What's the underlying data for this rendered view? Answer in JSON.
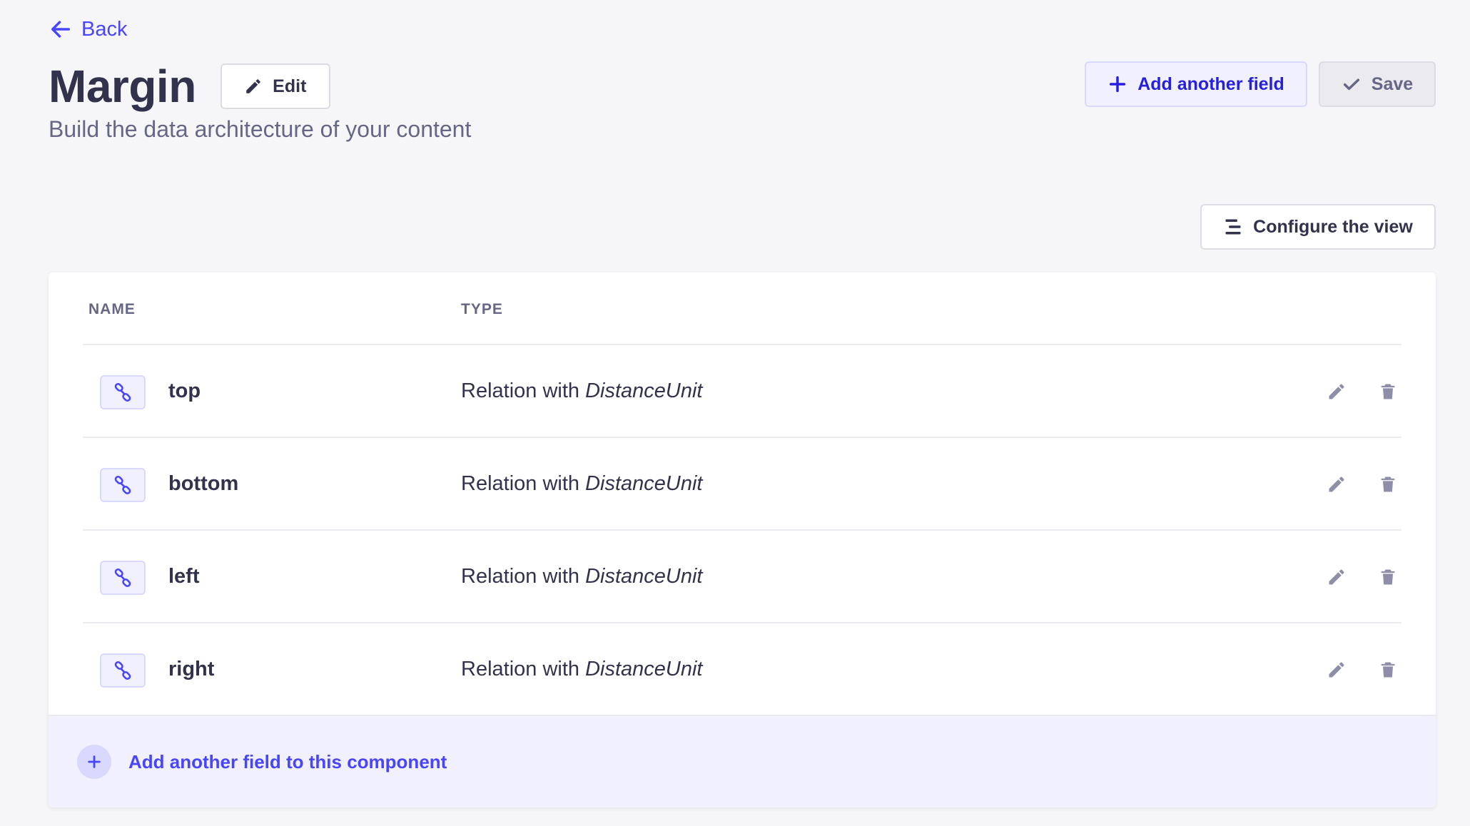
{
  "nav": {
    "back_label": "Back"
  },
  "header": {
    "title": "Margin",
    "edit_label": "Edit",
    "subtitle": "Build the data architecture of your content",
    "add_field_label": "Add another field",
    "save_label": "Save"
  },
  "view": {
    "configure_label": "Configure the view"
  },
  "table": {
    "columns": [
      "NAME",
      "TYPE"
    ],
    "rows": [
      {
        "name": "top",
        "type_prefix": "Relation with",
        "type_target": "DistanceUnit",
        "icon": "relation-icon"
      },
      {
        "name": "bottom",
        "type_prefix": "Relation with",
        "type_target": "DistanceUnit",
        "icon": "relation-icon"
      },
      {
        "name": "left",
        "type_prefix": "Relation with",
        "type_target": "DistanceUnit",
        "icon": "relation-icon"
      },
      {
        "name": "right",
        "type_prefix": "Relation with",
        "type_target": "DistanceUnit",
        "icon": "relation-icon"
      }
    ],
    "footer_label": "Add another field to this component"
  },
  "colors": {
    "primary": "#4945ff",
    "primary_light": "#f0f0ff",
    "text": "#32324d",
    "muted": "#666687",
    "icon_gray": "#8e8ea9",
    "background": "#f6f6f9"
  }
}
